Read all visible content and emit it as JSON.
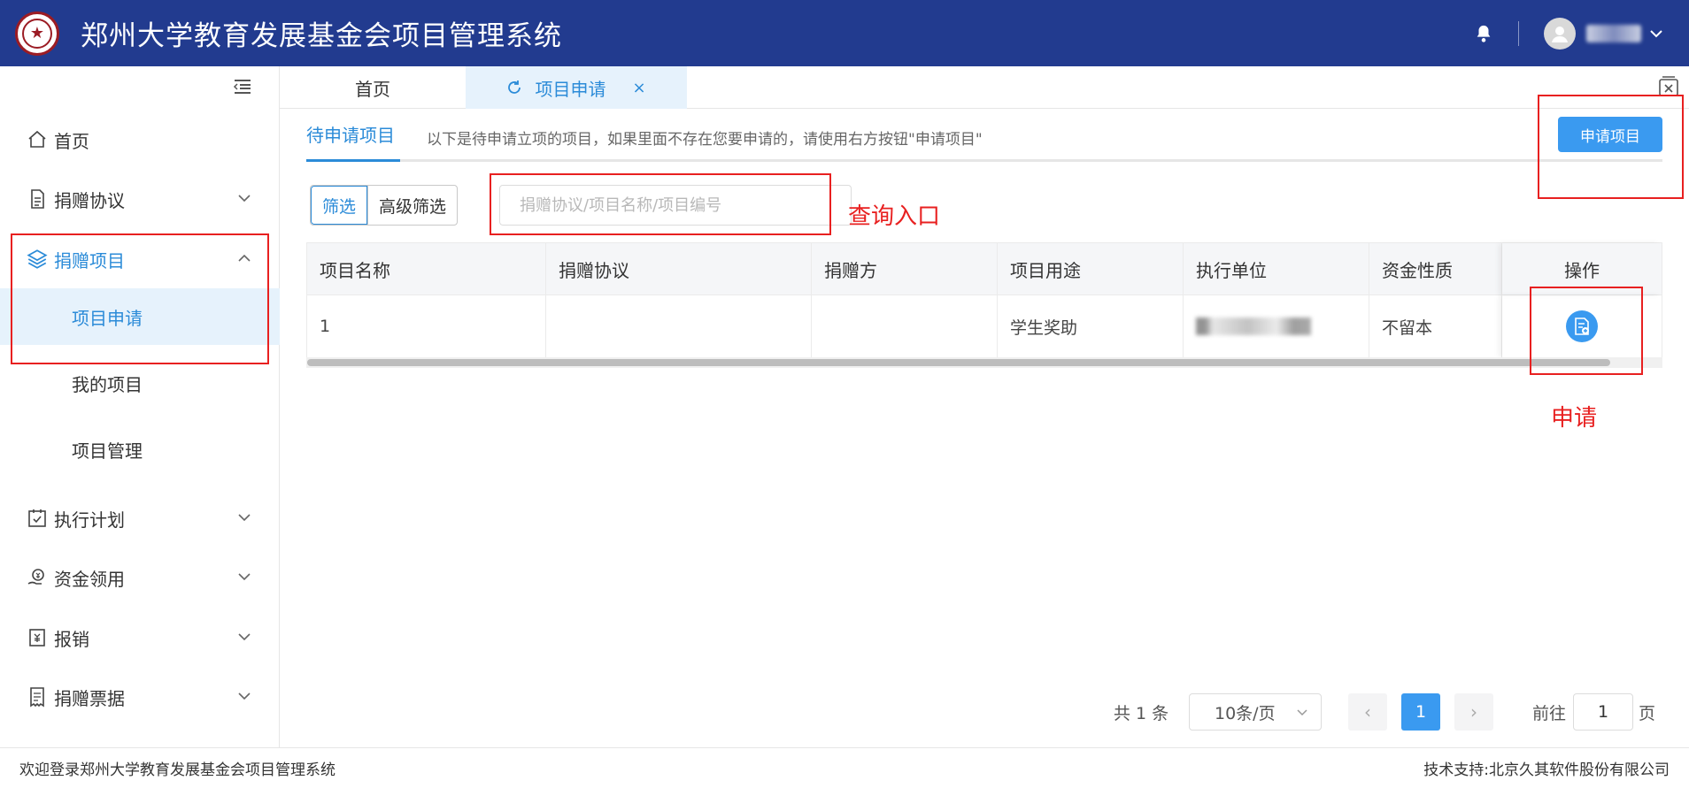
{
  "header": {
    "title": "郑州大学教育发展基金会项目管理系统",
    "logo_icon": "university-seal-icon",
    "bell_icon": "bell-icon",
    "avatar_icon": "user-avatar-icon"
  },
  "sidebar": {
    "items": [
      {
        "label": "首页",
        "icon": "home-icon"
      },
      {
        "label": "捐赠协议",
        "icon": "document-icon"
      },
      {
        "label": "捐赠项目",
        "icon": "layers-icon"
      },
      {
        "label": "执行计划",
        "icon": "calendar-check-icon"
      },
      {
        "label": "资金领用",
        "icon": "money-hand-icon"
      },
      {
        "label": "报销",
        "icon": "yuan-receipt-icon"
      },
      {
        "label": "捐赠票据",
        "icon": "invoice-icon"
      }
    ],
    "sub_items": [
      {
        "label": "项目申请"
      },
      {
        "label": "我的项目"
      },
      {
        "label": "项目管理"
      }
    ]
  },
  "tabs": {
    "home": "首页",
    "current": "项目申请",
    "close": "×"
  },
  "subnav": {
    "tab": "待申请项目",
    "desc": "以下是待申请立项的项目，如果里面不存在您要申请的，请使用右方按钮\"申请项目\"",
    "apply_button": "申请项目"
  },
  "filters": {
    "basic": "筛选",
    "advanced": "高级筛选",
    "search_placeholder": "捐赠协议/项目名称/项目编号"
  },
  "table": {
    "columns": [
      "项目名称",
      "捐赠协议",
      "捐赠方",
      "项目用途",
      "执行单位",
      "资金性质",
      "操作"
    ],
    "rows": [
      {
        "name": "1",
        "agreement": "",
        "donor": "",
        "purpose": "学生奖助",
        "unit": "",
        "fund": "不留本"
      }
    ]
  },
  "annotations": {
    "search": "查询入口",
    "apply": "申请"
  },
  "pagination": {
    "total": "共 1 条",
    "page_size": "10条/页",
    "prev": "‹",
    "next": "›",
    "current_page": "1",
    "goto_label": "前往",
    "goto_value": "1",
    "page_suffix": "页"
  },
  "footer": {
    "welcome": "欢迎登录郑州大学教育发展基金会项目管理系统",
    "support": "技术支持:北京久其软件股份有限公司"
  },
  "colors": {
    "header_bg": "#223b8f",
    "accent": "#2b8bd8",
    "primary_button": "#3a9af0",
    "annotation": "#e82020"
  }
}
